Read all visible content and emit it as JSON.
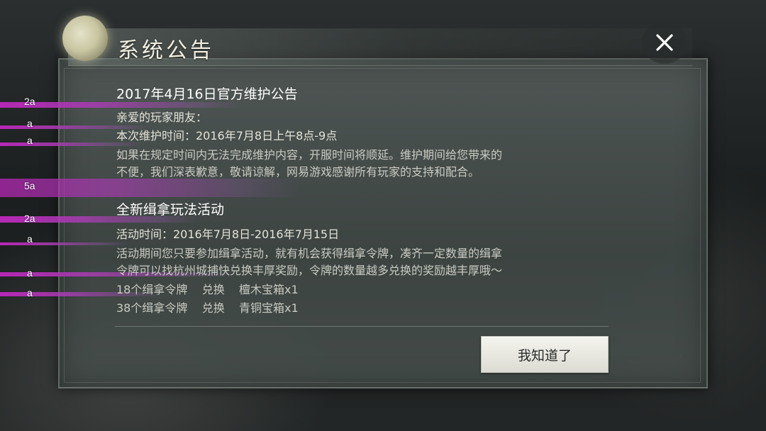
{
  "dialog": {
    "title": "系统公告",
    "close_icon": "close-icon",
    "accent_color": "#e9e6cb"
  },
  "overlay_labels": [
    {
      "text": "2a"
    },
    {
      "text": "a"
    },
    {
      "text": "a"
    },
    {
      "text": "5a"
    },
    {
      "text": "2a"
    },
    {
      "text": "a"
    },
    {
      "text": "a"
    },
    {
      "text": "a"
    }
  ],
  "notice1": {
    "title": "2017年4月16日官方维护公告",
    "greeting": "亲爱的玩家朋友：",
    "time": "本次维护时间：2016年7月8日上午8点-9点",
    "body_line1": "如果在规定时间内无法完成维护内容，开服时间将顺延。维护期间给您带来的",
    "body_line2": "不便，我们深表歉意，敬请谅解，网易游戏感谢所有玩家的支持和配合。"
  },
  "notice2": {
    "title": "全新缉拿玩法活动",
    "time": "活动时间：2016年7月8日-2016年7月15日",
    "body_line1": "活动期间您只要参加缉拿活动，就有机会获得缉拿令牌，凑齐一定数量的缉拿",
    "body_line2": "令牌可以找杭州城捕快兑换丰厚奖励，令牌的数量越多兑换的奖励越丰厚哦～",
    "reward1": "18个缉拿令牌    兑换    檀木宝箱x1",
    "reward2": "38个缉拿令牌    兑换    青铜宝箱x1"
  },
  "confirm_button": "我知道了"
}
